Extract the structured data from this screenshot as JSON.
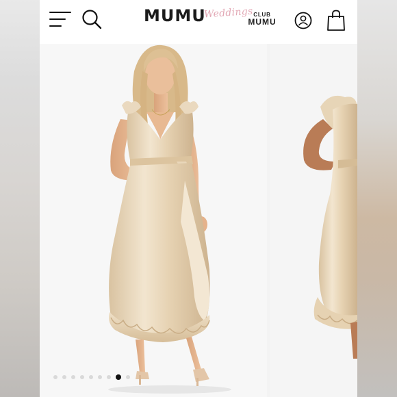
{
  "header": {
    "brand_main": "MUMU",
    "brand_script": "Weddings",
    "club_small": "CLUB",
    "club_big": "MUMU"
  },
  "icons": {
    "menu": "hamburger-menu-icon",
    "search": "search-icon",
    "account": "account-icon",
    "bag": "shopping-bag-icon"
  },
  "colors": {
    "dress": "#ead9bf",
    "dress_shadow": "#cdb38f",
    "skin": "#e5b28b",
    "hair": "#d8b98a",
    "script_pink": "#e2a7b4"
  },
  "gallery": {
    "slide_count": 8,
    "active_index": 7
  }
}
